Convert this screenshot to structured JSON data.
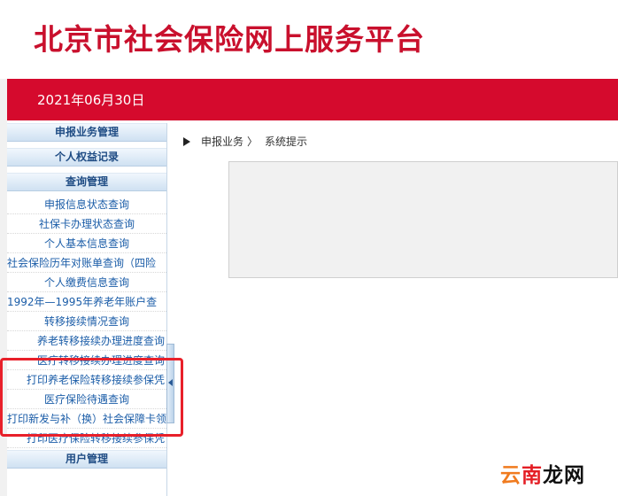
{
  "header": {
    "title": "北京市社会保险网上服务平台",
    "date": "2021年06月30日"
  },
  "sidebar": {
    "categories": [
      {
        "label": "申报业务管理"
      },
      {
        "label": "个人权益记录"
      },
      {
        "label": "查询管理"
      },
      {
        "label": "用户管理"
      }
    ],
    "query_items": [
      "申报信息状态查询",
      "社保卡办理状态查询",
      "个人基本信息查询",
      "社会保险历年对账单查询（四险",
      "个人缴费信息查询",
      "1992年—1995年养老年账户查",
      "转移接续情况查询",
      "养老转移接续办理进度查询",
      "医疗转移接续办理进度查询",
      "打印养老保险转移接续参保凭",
      "医疗保险待遇查询",
      "打印新发与补（换）社会保障卡领",
      "打印医疗保险转移接续参保凭"
    ]
  },
  "breadcrumb": {
    "section": "申报业务",
    "separator": "〉",
    "page": "系统提示"
  },
  "watermark": {
    "part1": "云",
    "part2": "南",
    "part3": "龙网"
  },
  "colors": {
    "brand_red": "#d50a2d",
    "title_red": "#c9102d",
    "link_blue": "#1b5da8",
    "highlight_red": "#e8202a"
  }
}
